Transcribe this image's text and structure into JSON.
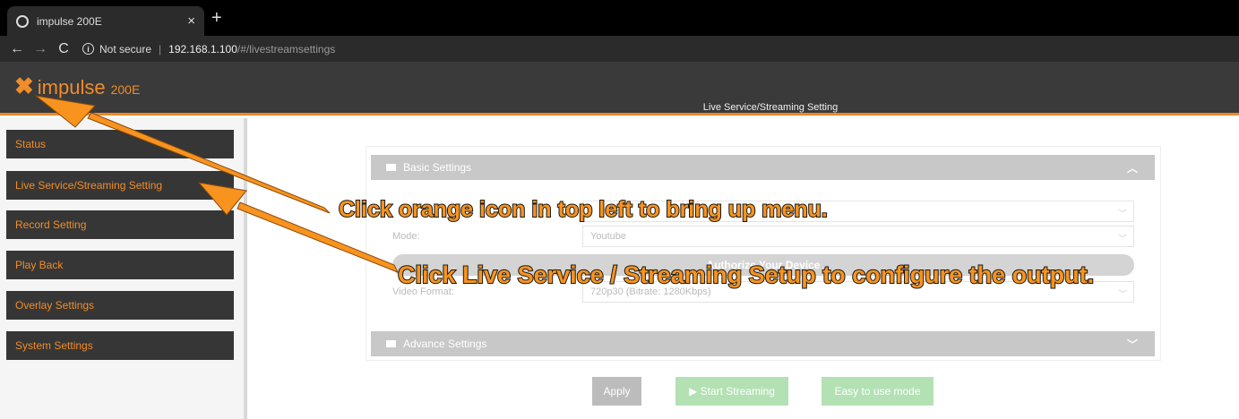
{
  "browser": {
    "tab_title": "impulse 200E",
    "tab_close": "×",
    "new_tab": "+",
    "nav_back": "←",
    "nav_forward": "→",
    "nav_reload": "C",
    "security_label": "Not secure",
    "url_host": "192.168.1.100",
    "url_path": "/#/livestreamsettings"
  },
  "header": {
    "logo_mark": "✖",
    "logo_text": "impulse",
    "logo_model": "200E",
    "page_title": "Live Service/Streaming Setting"
  },
  "sidebar": {
    "items": [
      {
        "label": "Status"
      },
      {
        "label": "Live Service/Streaming Setting"
      },
      {
        "label": "Record Setting"
      },
      {
        "label": "Play Back"
      },
      {
        "label": "Overlay Settings"
      },
      {
        "label": "System Settings"
      }
    ]
  },
  "main": {
    "basic_settings": {
      "title": "Basic Settings",
      "mode_label": "Mode:",
      "mode_value": "Youtube",
      "authorize_button": "Authorize Your Device",
      "video_label": "Video Format:",
      "video_value": "720p30 (Bitrate: 1280Kbps)"
    },
    "advance_settings": {
      "title": "Advance Settings"
    },
    "buttons": {
      "apply": "Apply",
      "start_streaming": "▶ Start Streaming",
      "easy_mode": "Easy to use mode"
    }
  },
  "annotations": {
    "text1": "Click orange icon in top left to bring up menu.",
    "text2": "Click Live Service / Streaming Setup to configure the output."
  },
  "colors": {
    "accent_orange": "#f08c2a",
    "annotation_orange": "#f7931e",
    "sidebar_item_bg": "#363636",
    "header_bg": "#3a3a3a",
    "section_bar_bg": "#c8c8c8",
    "green_button_bg": "#b3e1b3"
  }
}
